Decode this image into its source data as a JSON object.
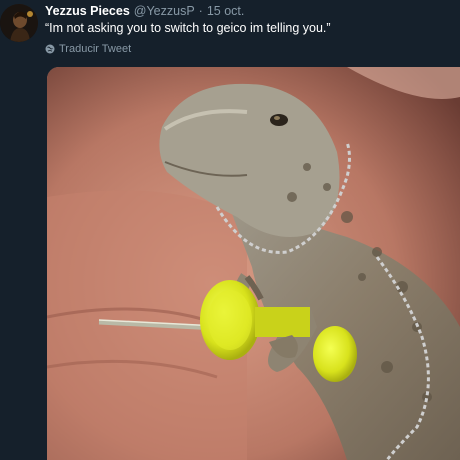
{
  "tweet": {
    "display_name": "Yezzus Pieces",
    "handle": "@YezzusP",
    "separator": "·",
    "timestamp": "15 oct.",
    "text": "“Im not asking you to switch to geico im telling you.”",
    "translate_label": "Traducir Tweet"
  },
  "icons": {
    "avatar": "avatar-image",
    "translate": "globe-icon"
  },
  "colors": {
    "background": "#15202b",
    "primary_text": "#ffffff",
    "secondary_text": "#8899a6"
  }
}
